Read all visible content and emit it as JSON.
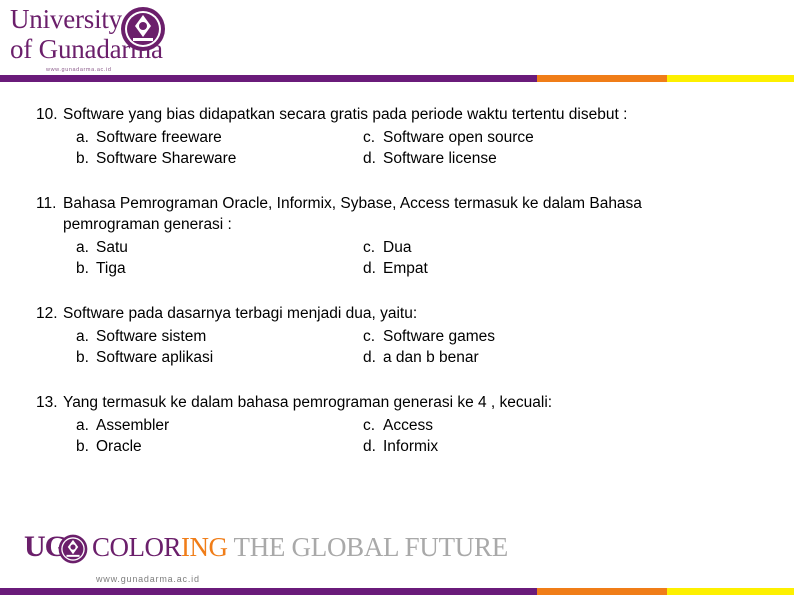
{
  "header": {
    "logo_line1": "University",
    "logo_line2": "of Gunadarma",
    "logo_url": "www.gunadarma.ac.id",
    "emblem_icon": "gunadarma-emblem-icon",
    "rule_colors": {
      "purple": "#6a1b7a",
      "orange": "#f07d18",
      "yellow": "#fdf000"
    }
  },
  "questions": [
    {
      "number": "10.",
      "text": "Software yang bias didapatkan secara gratis pada periode waktu tertentu disebut :",
      "continuation": "",
      "options": [
        {
          "label": "a.",
          "text": "Software freeware"
        },
        {
          "label": "c.",
          "text": "Software open source"
        },
        {
          "label": "b.",
          "text": "Software Shareware"
        },
        {
          "label": "d.",
          "text": "Software license"
        }
      ]
    },
    {
      "number": "11.",
      "text": "Bahasa Pemrograman Oracle, Informix, Sybase, Access termasuk ke dalam Bahasa",
      "continuation": "pemrograman generasi :",
      "options": [
        {
          "label": "a.",
          "text": "Satu"
        },
        {
          "label": "c.",
          "text": "Dua"
        },
        {
          "label": "b.",
          "text": "Tiga"
        },
        {
          "label": "d.",
          "text": "Empat"
        }
      ]
    },
    {
      "number": "12.",
      "text": "Software pada dasarnya terbagi menjadi dua, yaitu:",
      "continuation": "",
      "options": [
        {
          "label": "a.",
          "text": "Software sistem"
        },
        {
          "label": "c.",
          "text": "Software games"
        },
        {
          "label": "b.",
          "text": "Software aplikasi"
        },
        {
          "label": "d.",
          "text": "a dan b benar"
        }
      ]
    },
    {
      "number": "13.",
      "text": "Yang termasuk ke dalam bahasa pemrograman generasi ke 4 , kecuali:",
      "continuation": "",
      "options": [
        {
          "label": "a.",
          "text": "Assembler"
        },
        {
          "label": "c.",
          "text": "Access"
        },
        {
          "label": "b.",
          "text": "Oracle"
        },
        {
          "label": "d.",
          "text": "Informix"
        }
      ]
    }
  ],
  "footer": {
    "brand_ug": "UG",
    "brand_color_word_1": "COLOR",
    "brand_color_word_2": "ING",
    "brand_rest": "THE GLOBAL FUTURE",
    "url": "www.gunadarma.ac.id",
    "emblem_icon": "gunadarma-emblem-icon"
  }
}
